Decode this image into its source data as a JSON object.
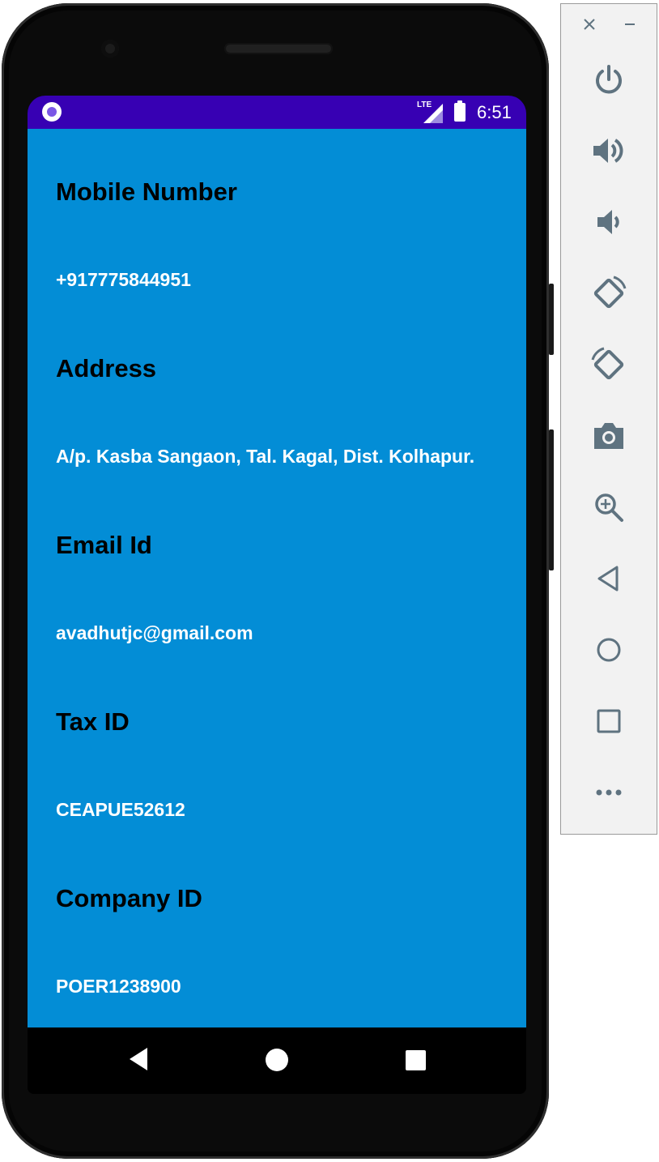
{
  "status_bar": {
    "network_label": "LTE",
    "time": "6:51",
    "accent_color": "#3700b3"
  },
  "content": {
    "background_color": "#038dd6",
    "fields": [
      {
        "label": "Mobile Number",
        "value": "+917775844951"
      },
      {
        "label": "Address",
        "value": "A/p. Kasba Sangaon, Tal. Kagal, Dist. Kolhapur."
      },
      {
        "label": "Email Id",
        "value": "avadhutjc@gmail.com"
      },
      {
        "label": "Tax ID",
        "value": "CEAPUE52612"
      },
      {
        "label": "Company ID",
        "value": "POER1238900"
      }
    ]
  },
  "nav_bar": {
    "buttons": [
      "back-icon",
      "home-icon",
      "recents-icon"
    ]
  },
  "emulator_toolbar": {
    "window_controls": [
      "close-icon",
      "minimize-icon"
    ],
    "buttons": [
      "power-icon",
      "volume-up-icon",
      "volume-down-icon",
      "rotate-left-icon",
      "rotate-right-icon",
      "camera-icon",
      "zoom-icon",
      "back-icon",
      "home-icon",
      "overview-icon",
      "more-icon"
    ],
    "icon_color": "#5f7380"
  }
}
